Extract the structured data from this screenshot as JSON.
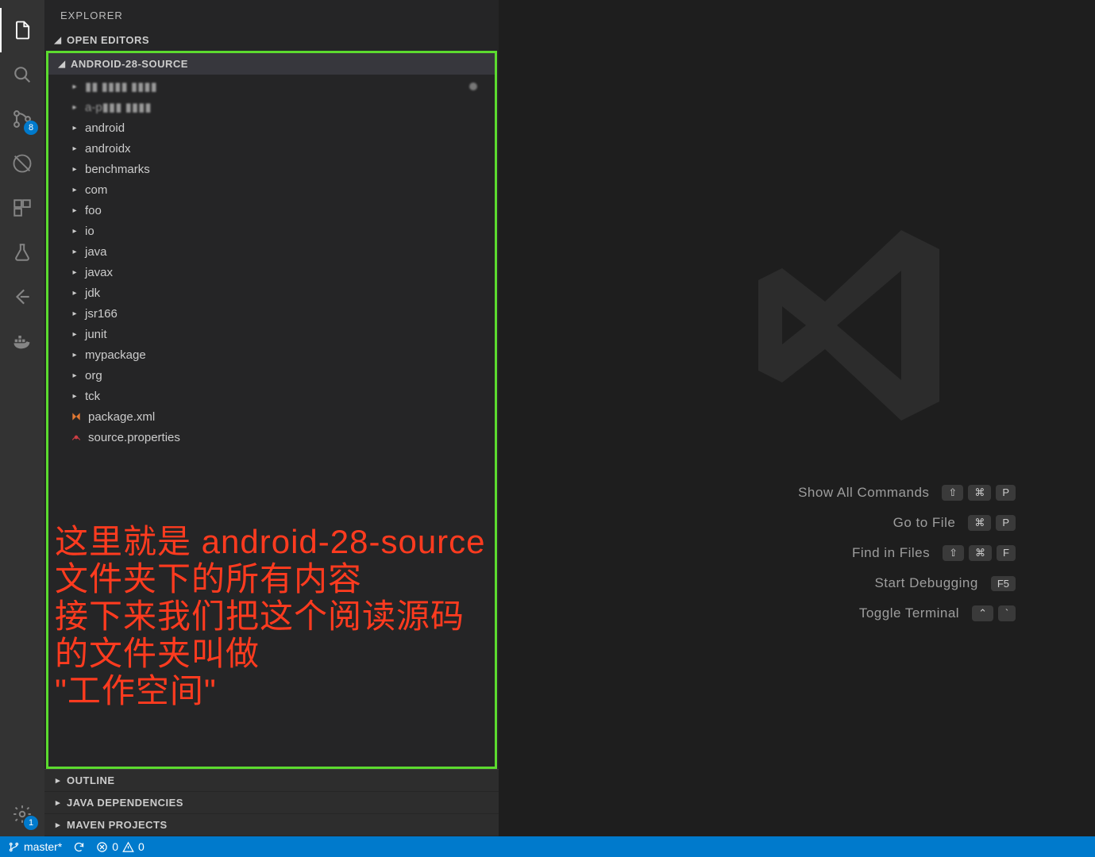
{
  "sidebar_title": "EXPLORER",
  "sections": {
    "open_editors": "OPEN EDITORS",
    "project": "ANDROID-28-SOURCE",
    "outline": "OUTLINE",
    "java_deps": "JAVA DEPENDENCIES",
    "maven": "MAVEN PROJECTS"
  },
  "tree": [
    {
      "type": "folder-blur",
      "label": "▮▮ ▮▮▮▮ ▮▮▮▮"
    },
    {
      "type": "folder-blur2",
      "label": "a-p▮▮▮ ▮▮▮▮"
    },
    {
      "type": "folder",
      "label": "android"
    },
    {
      "type": "folder",
      "label": "androidx"
    },
    {
      "type": "folder",
      "label": "benchmarks"
    },
    {
      "type": "folder",
      "label": "com"
    },
    {
      "type": "folder",
      "label": "foo"
    },
    {
      "type": "folder",
      "label": "io"
    },
    {
      "type": "folder",
      "label": "java"
    },
    {
      "type": "folder",
      "label": "javax"
    },
    {
      "type": "folder",
      "label": "jdk"
    },
    {
      "type": "folder",
      "label": "jsr166"
    },
    {
      "type": "folder",
      "label": "junit"
    },
    {
      "type": "folder",
      "label": "mypackage"
    },
    {
      "type": "folder",
      "label": "org"
    },
    {
      "type": "folder",
      "label": "tck"
    },
    {
      "type": "file-xml",
      "label": "package.xml"
    },
    {
      "type": "file-prop",
      "label": "source.properties"
    }
  ],
  "annotation": {
    "line1": "这里就是 android-28-source",
    "line2": "文件夹下的所有内容",
    "line3": "接下来我们把这个阅读源码的文件夹叫做",
    "line4": "\"工作空间\""
  },
  "commands": [
    {
      "label": "Show All Commands",
      "keys": [
        "⇧",
        "⌘",
        "P"
      ]
    },
    {
      "label": "Go to File",
      "keys": [
        "⌘",
        "P"
      ]
    },
    {
      "label": "Find in Files",
      "keys": [
        "⇧",
        "⌘",
        "F"
      ]
    },
    {
      "label": "Start Debugging",
      "keys": [
        "F5"
      ]
    },
    {
      "label": "Toggle Terminal",
      "keys": [
        "⌃",
        "`"
      ]
    }
  ],
  "activity_badge_scm": "8",
  "activity_badge_settings": "1",
  "status": {
    "branch": "master*",
    "errors": "0",
    "warnings": "0"
  }
}
